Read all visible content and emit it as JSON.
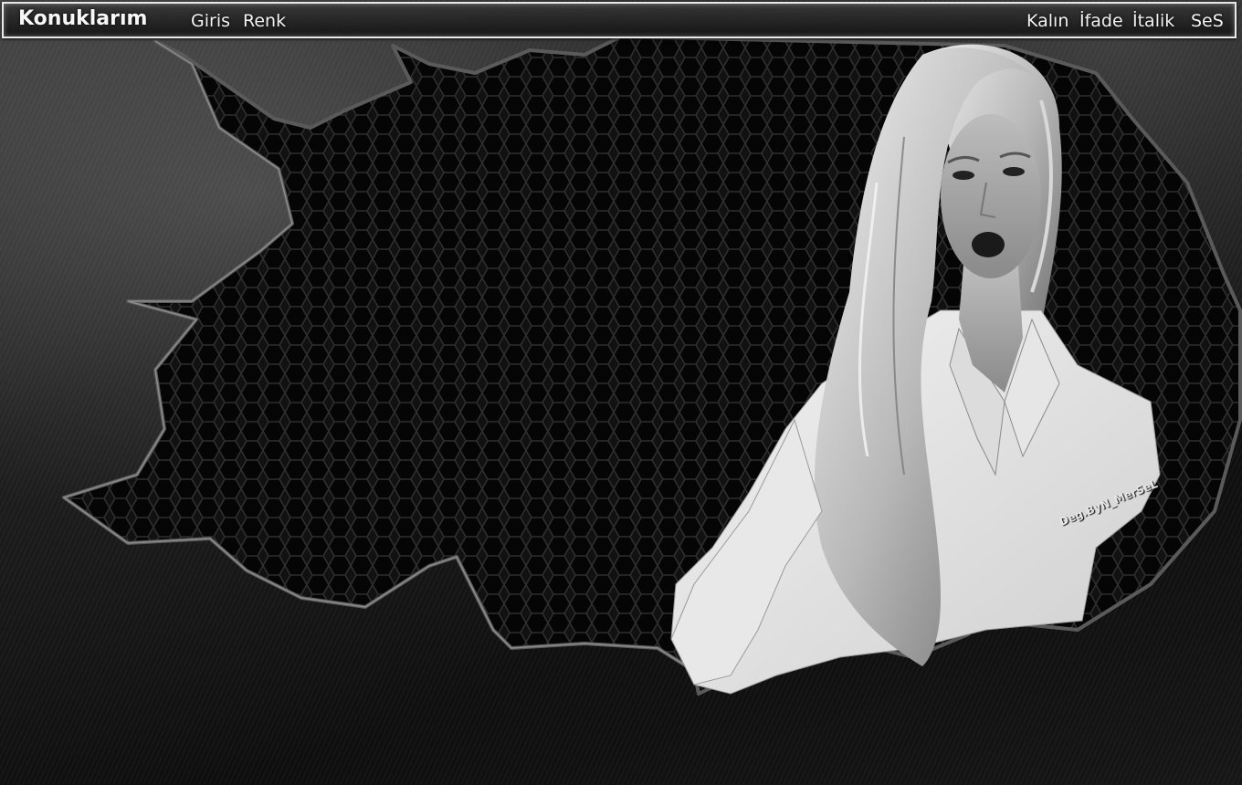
{
  "topbar": {
    "logo": "Konuklarım",
    "left_menu": [
      "Giris",
      "Renk"
    ],
    "right_menu": [
      "Kalın",
      "İfade",
      "İtalik",
      "SeS"
    ]
  },
  "signature": "Deg.ByN_MerSeL",
  "colors": {
    "background": "#0c0c0c",
    "bar_border": "#e9e9e9",
    "text": "#f2f2f2"
  }
}
